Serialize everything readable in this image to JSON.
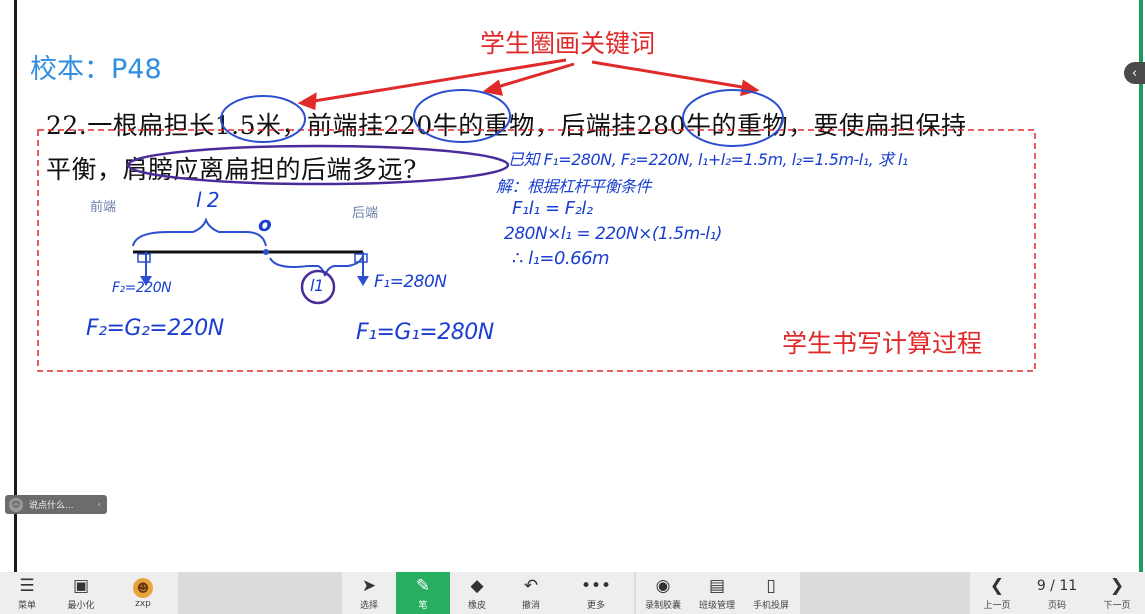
{
  "board": {
    "section_title": "校本：P48",
    "annotation_top": "学生圈画关键词",
    "annotation_bottom": "学生书写计算过程",
    "problem_line1": "22.一根扁担长1.5米，前端挂220牛的重物，后端挂280牛的重物，要使扁担保持",
    "problem_line2": "平衡，肩膀应离扁担的后端多远?",
    "diagram": {
      "front_label": "前端",
      "back_label": "后端",
      "l2": "l 2",
      "pivot": "o",
      "l1": "l1",
      "f2_arrow": "F₂=220N",
      "f1_arrow": "F₁=280N",
      "f2_eq": "F₂=G₂=220N",
      "f1_eq": "F₁=G₁=280N"
    },
    "work_lines": [
      "已知 F₁=280N, F₂=220N, l₁+l₂=1.5m, l₂=1.5m-l₁, 求 l₁",
      "解：根据杠杆平衡条件",
      "F₁l₁ = F₂l₂",
      "280N×l₁ = 220N×(1.5m-l₁)",
      "∴ l₁=0.66m"
    ]
  },
  "comment_box": {
    "placeholder": "说点什么..."
  },
  "taskbar": {
    "left": [
      {
        "label": "菜单",
        "icon": "menu-icon"
      },
      {
        "label": "最小化",
        "icon": "minimize-icon"
      },
      {
        "label": "zxp",
        "icon": "avatar-icon"
      }
    ],
    "tools": [
      {
        "label": "选择",
        "icon": "cursor-icon"
      },
      {
        "label": "笔",
        "icon": "pen-icon"
      },
      {
        "label": "橡皮",
        "icon": "eraser-icon"
      },
      {
        "label": "撤消",
        "icon": "undo-icon"
      },
      {
        "label": "更多",
        "icon": "more-icon"
      }
    ],
    "extras": [
      {
        "label": "录制胶囊",
        "icon": "record-icon"
      },
      {
        "label": "班级管理",
        "icon": "class-manage-icon"
      },
      {
        "label": "手机投屏",
        "icon": "phone-cast-icon"
      }
    ],
    "nav": {
      "prev": "上一页",
      "page_label": "页码",
      "page": "9 / 11",
      "next": "下一页"
    }
  },
  "colors": {
    "accent_green": "#27ae60",
    "annotation_red": "#e02a2a",
    "ink_blue": "#1a3fd0",
    "circle_purple": "#4a2b9a",
    "title_blue": "#2f8ee0"
  }
}
